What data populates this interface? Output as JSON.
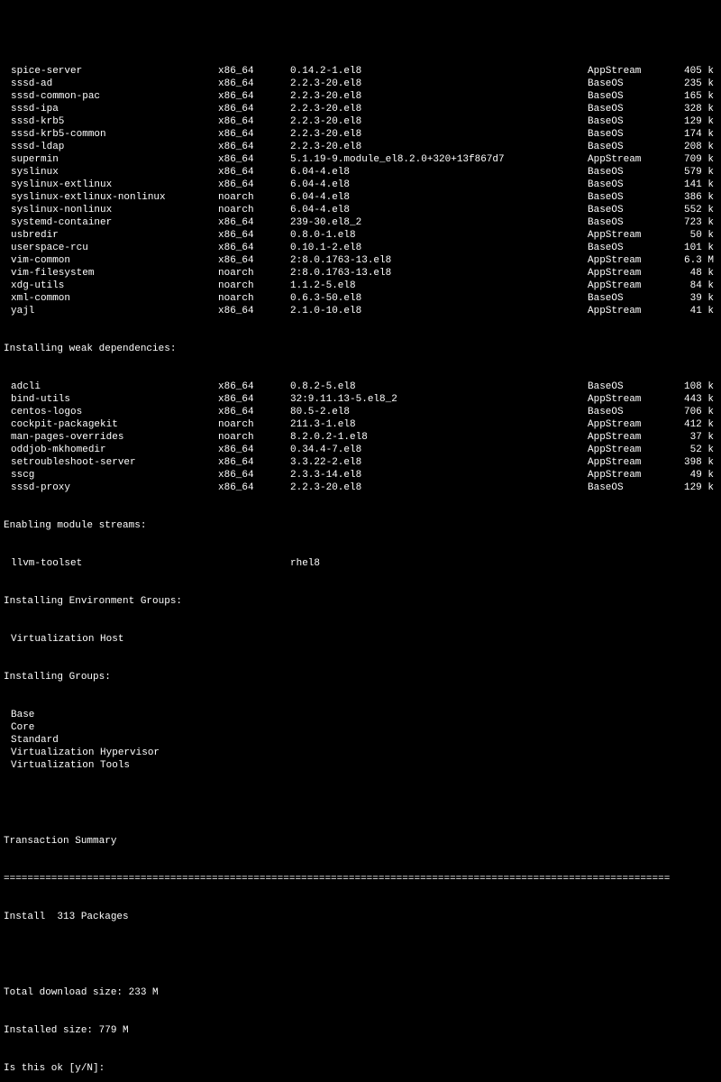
{
  "packages": [
    {
      "name": "spice-server",
      "arch": "x86_64",
      "ver": "0.14.2-1.el8",
      "repo": "AppStream",
      "size": "405 k"
    },
    {
      "name": "sssd-ad",
      "arch": "x86_64",
      "ver": "2.2.3-20.el8",
      "repo": "BaseOS",
      "size": "235 k"
    },
    {
      "name": "sssd-common-pac",
      "arch": "x86_64",
      "ver": "2.2.3-20.el8",
      "repo": "BaseOS",
      "size": "165 k"
    },
    {
      "name": "sssd-ipa",
      "arch": "x86_64",
      "ver": "2.2.3-20.el8",
      "repo": "BaseOS",
      "size": "328 k"
    },
    {
      "name": "sssd-krb5",
      "arch": "x86_64",
      "ver": "2.2.3-20.el8",
      "repo": "BaseOS",
      "size": "129 k"
    },
    {
      "name": "sssd-krb5-common",
      "arch": "x86_64",
      "ver": "2.2.3-20.el8",
      "repo": "BaseOS",
      "size": "174 k"
    },
    {
      "name": "sssd-ldap",
      "arch": "x86_64",
      "ver": "2.2.3-20.el8",
      "repo": "BaseOS",
      "size": "208 k"
    },
    {
      "name": "supermin",
      "arch": "x86_64",
      "ver": "5.1.19-9.module_el8.2.0+320+13f867d7",
      "repo": "AppStream",
      "size": "709 k"
    },
    {
      "name": "syslinux",
      "arch": "x86_64",
      "ver": "6.04-4.el8",
      "repo": "BaseOS",
      "size": "579 k"
    },
    {
      "name": "syslinux-extlinux",
      "arch": "x86_64",
      "ver": "6.04-4.el8",
      "repo": "BaseOS",
      "size": "141 k"
    },
    {
      "name": "syslinux-extlinux-nonlinux",
      "arch": "noarch",
      "ver": "6.04-4.el8",
      "repo": "BaseOS",
      "size": "386 k"
    },
    {
      "name": "syslinux-nonlinux",
      "arch": "noarch",
      "ver": "6.04-4.el8",
      "repo": "BaseOS",
      "size": "552 k"
    },
    {
      "name": "systemd-container",
      "arch": "x86_64",
      "ver": "239-30.el8_2",
      "repo": "BaseOS",
      "size": "723 k"
    },
    {
      "name": "usbredir",
      "arch": "x86_64",
      "ver": "0.8.0-1.el8",
      "repo": "AppStream",
      "size": "50 k"
    },
    {
      "name": "userspace-rcu",
      "arch": "x86_64",
      "ver": "0.10.1-2.el8",
      "repo": "BaseOS",
      "size": "101 k"
    },
    {
      "name": "vim-common",
      "arch": "x86_64",
      "ver": "2:8.0.1763-13.el8",
      "repo": "AppStream",
      "size": "6.3 M"
    },
    {
      "name": "vim-filesystem",
      "arch": "noarch",
      "ver": "2:8.0.1763-13.el8",
      "repo": "AppStream",
      "size": "48 k"
    },
    {
      "name": "xdg-utils",
      "arch": "noarch",
      "ver": "1.1.2-5.el8",
      "repo": "AppStream",
      "size": "84 k"
    },
    {
      "name": "xml-common",
      "arch": "noarch",
      "ver": "0.6.3-50.el8",
      "repo": "BaseOS",
      "size": "39 k"
    },
    {
      "name": "yajl",
      "arch": "x86_64",
      "ver": "2.1.0-10.el8",
      "repo": "AppStream",
      "size": "41 k"
    }
  ],
  "weak_header": "Installing weak dependencies:",
  "weak_packages": [
    {
      "name": "adcli",
      "arch": "x86_64",
      "ver": "0.8.2-5.el8",
      "repo": "BaseOS",
      "size": "108 k"
    },
    {
      "name": "bind-utils",
      "arch": "x86_64",
      "ver": "32:9.11.13-5.el8_2",
      "repo": "AppStream",
      "size": "443 k"
    },
    {
      "name": "centos-logos",
      "arch": "x86_64",
      "ver": "80.5-2.el8",
      "repo": "BaseOS",
      "size": "706 k"
    },
    {
      "name": "cockpit-packagekit",
      "arch": "noarch",
      "ver": "211.3-1.el8",
      "repo": "AppStream",
      "size": "412 k"
    },
    {
      "name": "man-pages-overrides",
      "arch": "noarch",
      "ver": "8.2.0.2-1.el8",
      "repo": "AppStream",
      "size": "37 k"
    },
    {
      "name": "oddjob-mkhomedir",
      "arch": "x86_64",
      "ver": "0.34.4-7.el8",
      "repo": "AppStream",
      "size": "52 k"
    },
    {
      "name": "setroubleshoot-server",
      "arch": "x86_64",
      "ver": "3.3.22-2.el8",
      "repo": "AppStream",
      "size": "398 k"
    },
    {
      "name": "sscg",
      "arch": "x86_64",
      "ver": "2.3.3-14.el8",
      "repo": "AppStream",
      "size": "49 k"
    },
    {
      "name": "sssd-proxy",
      "arch": "x86_64",
      "ver": "2.2.3-20.el8",
      "repo": "BaseOS",
      "size": "129 k"
    }
  ],
  "module_header": "Enabling module streams:",
  "modules": [
    {
      "name": "llvm-toolset",
      "ver": "rhel8"
    }
  ],
  "env_header": "Installing Environment Groups:",
  "env_groups": [
    "Virtualization Host"
  ],
  "groups_header": "Installing Groups:",
  "groups": [
    "Base",
    "Core",
    "Standard",
    "Virtualization Hypervisor",
    "Virtualization Tools"
  ],
  "summary_header": "Transaction Summary",
  "rule": "================================================================================================================",
  "install_line": "Install  313 Packages",
  "dl_size": "Total download size: 233 M",
  "inst_size": "Installed size: 779 M",
  "prompt": "Is this ok [y/N]: "
}
